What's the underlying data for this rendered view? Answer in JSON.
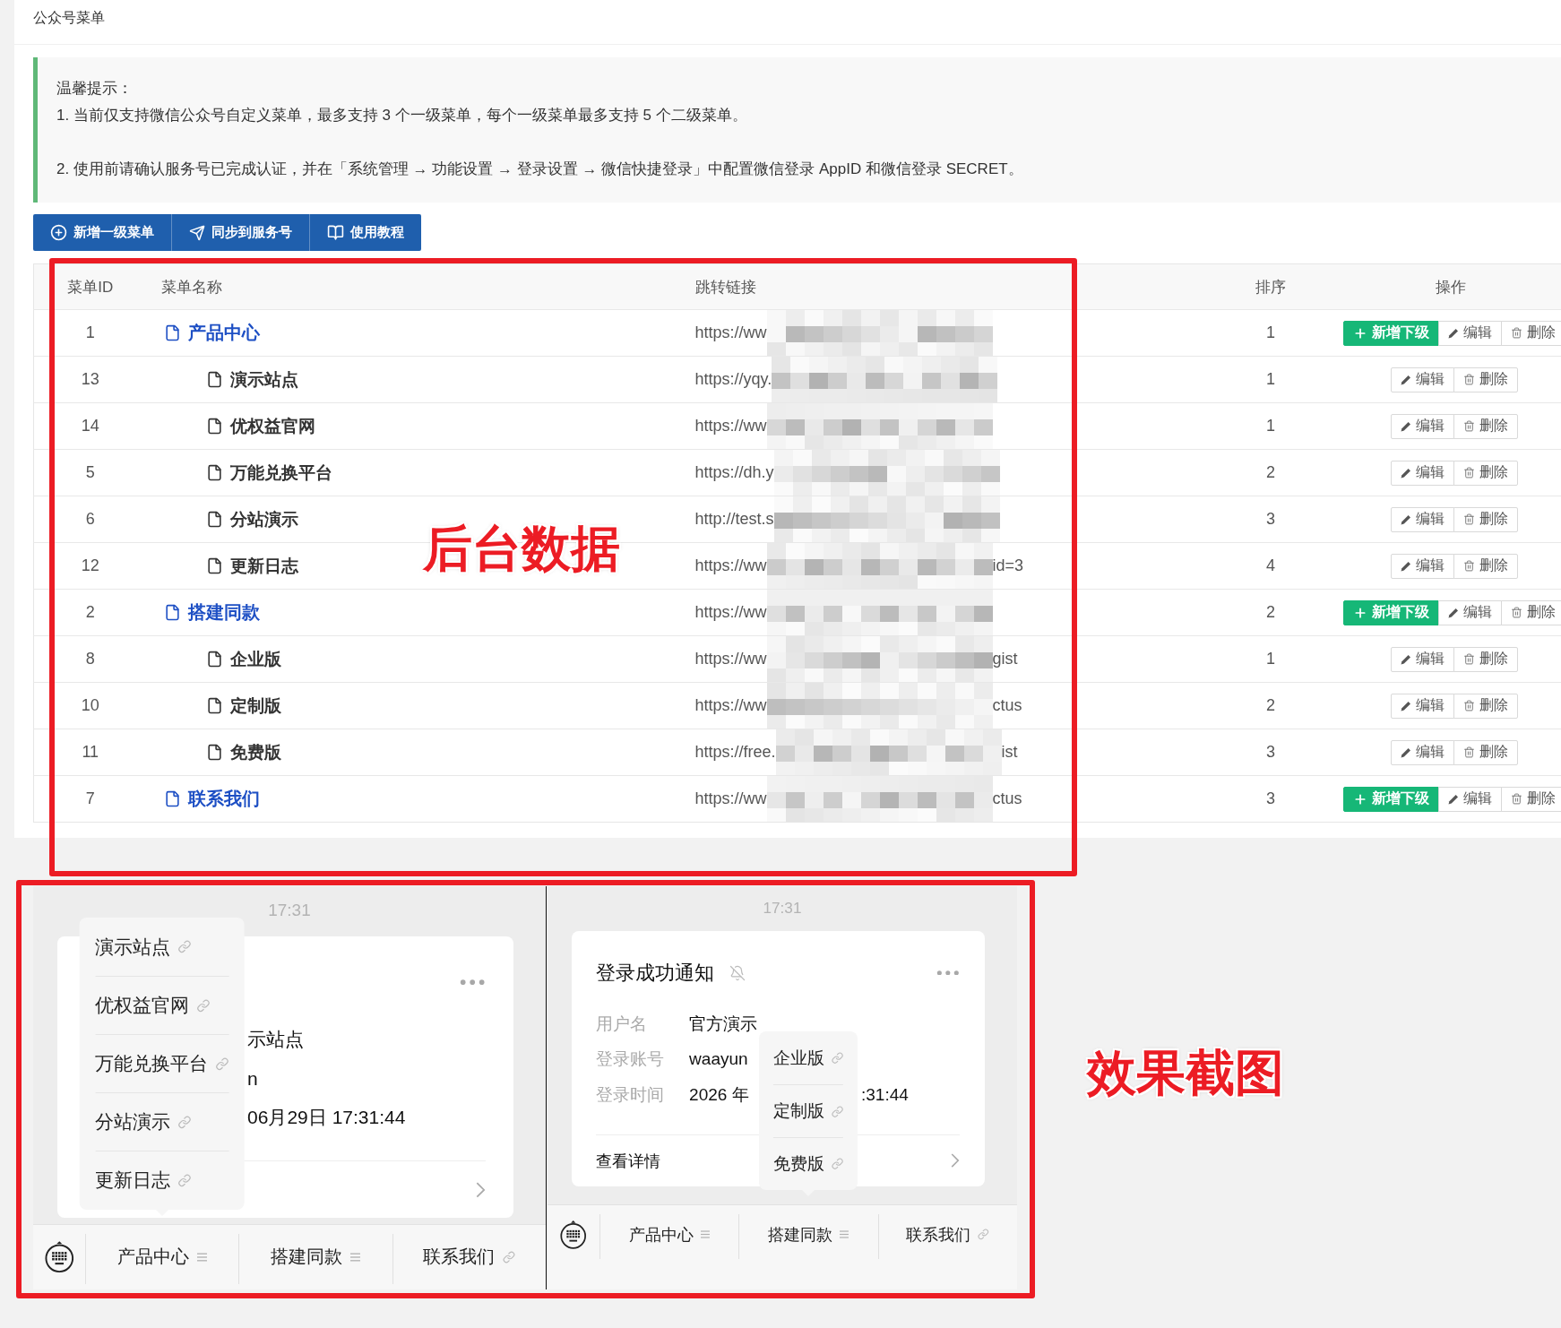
{
  "page_title": "公众号菜单",
  "tip": {
    "heading": "温馨提示：",
    "lines": [
      "1. 当前仅支持微信公众号自定义菜单，最多支持 3 个一级菜单，每个一级菜单最多支持 5 个二级菜单。",
      "2. 使用前请确认服务号已完成认证，并在「系统管理 → 功能设置 → 登录设置 → 微信快捷登录」中配置微信登录 AppID 和微信登录 SECRET。"
    ]
  },
  "toolbar": [
    {
      "kind": "add",
      "label": "新增一级菜单"
    },
    {
      "kind": "sync",
      "label": "同步到服务号"
    },
    {
      "kind": "guide",
      "label": "使用教程"
    }
  ],
  "table": {
    "columns": [
      "菜单ID",
      "菜单名称",
      "跳转链接",
      "排序",
      "操作"
    ],
    "rows": [
      {
        "id": "1",
        "name": "产品中心",
        "link_start": "https://ww",
        "sort": "1",
        "actions": [
          {
            "kind": "add",
            "label": "新增下级"
          },
          {
            "kind": "edit",
            "label": "编辑"
          },
          {
            "kind": "delete",
            "label": "删除"
          }
        ],
        "children": [
          {
            "id": "13",
            "name": "演示站点",
            "link_start": "https://yqy.",
            "sort": "1",
            "actions": [
              {
                "kind": "edit",
                "label": "编辑"
              },
              {
                "kind": "delete",
                "label": "删除"
              }
            ]
          },
          {
            "id": "14",
            "name": "优权益官网",
            "link_start": "https://ww",
            "sort": "1",
            "actions": [
              {
                "kind": "edit",
                "label": "编辑"
              },
              {
                "kind": "delete",
                "label": "删除"
              }
            ]
          },
          {
            "id": "5",
            "name": "万能兑换平台",
            "link_start": "https://dh.y",
            "sort": "2",
            "actions": [
              {
                "kind": "edit",
                "label": "编辑"
              },
              {
                "kind": "delete",
                "label": "删除"
              }
            ]
          },
          {
            "id": "6",
            "name": "分站演示",
            "link_start": "http://test.s",
            "sort": "3",
            "actions": [
              {
                "kind": "edit",
                "label": "编辑"
              },
              {
                "kind": "delete",
                "label": "删除"
              }
            ]
          },
          {
            "id": "12",
            "name": "更新日志",
            "link_start": "https://ww",
            "link_end": "id=3",
            "sort": "4",
            "actions": [
              {
                "kind": "edit",
                "label": "编辑"
              },
              {
                "kind": "delete",
                "label": "删除"
              }
            ]
          }
        ]
      },
      {
        "id": "2",
        "name": "搭建同款",
        "link_start": "https://ww",
        "sort": "2",
        "actions": [
          {
            "kind": "add",
            "label": "新增下级"
          },
          {
            "kind": "edit",
            "label": "编辑"
          },
          {
            "kind": "delete",
            "label": "删除"
          }
        ],
        "children": [
          {
            "id": "8",
            "name": "企业版",
            "link_start": "https://ww",
            "link_end": "gist",
            "sort": "1",
            "actions": [
              {
                "kind": "edit",
                "label": "编辑"
              },
              {
                "kind": "delete",
                "label": "删除"
              }
            ]
          },
          {
            "id": "10",
            "name": "定制版",
            "link_start": "https://ww",
            "link_end": "ctus",
            "sort": "2",
            "actions": [
              {
                "kind": "edit",
                "label": "编辑"
              },
              {
                "kind": "delete",
                "label": "删除"
              }
            ]
          },
          {
            "id": "11",
            "name": "免费版",
            "link_start": "https://free.",
            "link_end": "ist",
            "sort": "3",
            "actions": [
              {
                "kind": "edit",
                "label": "编辑"
              },
              {
                "kind": "delete",
                "label": "删除"
              }
            ]
          }
        ]
      },
      {
        "id": "7",
        "name": "联系我们",
        "link_start": "https://ww",
        "link_end": "ctus",
        "sort": "3",
        "actions": [
          {
            "kind": "add",
            "label": "新增下级"
          },
          {
            "kind": "edit",
            "label": "编辑"
          },
          {
            "kind": "delete",
            "label": "删除"
          }
        ]
      }
    ]
  },
  "previews": [
    {
      "time": "17:31",
      "card": {
        "rows": [
          {
            "value": "示站点"
          },
          {
            "value": "n"
          },
          {
            "value": "06月29日 17:31:44"
          }
        ]
      },
      "menu": [
        {
          "label": "产品中心",
          "kind": "submenu",
          "submenu": [
            "演示站点",
            "优权益官网",
            "万能兑换平台",
            "分站演示",
            "更新日志"
          ]
        },
        {
          "label": "搭建同款",
          "kind": "submenu"
        },
        {
          "label": "联系我们",
          "kind": "link"
        }
      ]
    },
    {
      "time": "17:31",
      "card": {
        "title": "登录成功通知",
        "rows": [
          {
            "label": "用户名",
            "value": "官方演示"
          },
          {
            "label": "登录账号",
            "value": "waayun"
          },
          {
            "label": "登录时间",
            "value": "2026 年",
            "value_end": ":31:44"
          }
        ],
        "footer": "查看详情"
      },
      "menu": [
        {
          "label": "产品中心",
          "kind": "submenu"
        },
        {
          "label": "搭建同款",
          "kind": "submenu",
          "submenu": [
            "企业版",
            "定制版",
            "免费版"
          ]
        },
        {
          "label": "联系我们",
          "kind": "link"
        }
      ]
    }
  ],
  "annotations": [
    {
      "label": "后台数据"
    },
    {
      "label": "效果截图"
    }
  ]
}
